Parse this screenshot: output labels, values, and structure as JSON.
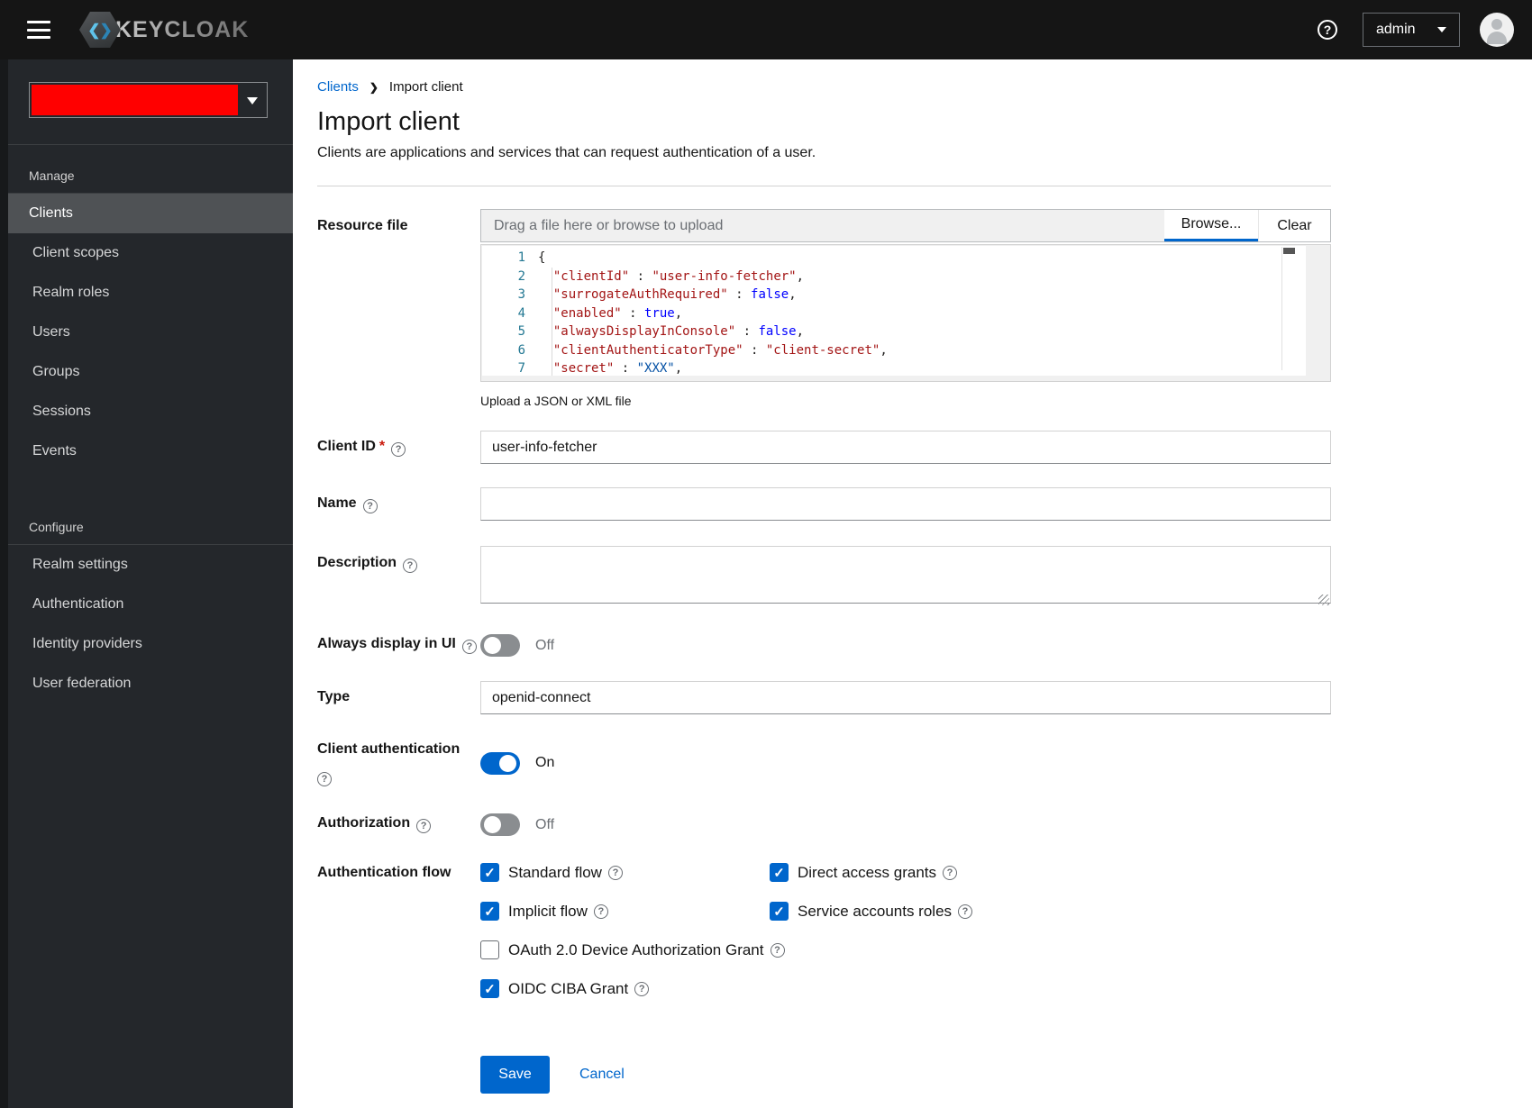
{
  "colors": {
    "accent_blue": "#0066cc",
    "header_bg": "#151515",
    "sidebar_bg": "#24272b",
    "nav_selected_bg": "#4f5255",
    "nav_accent": "#2b9af3",
    "realm_redaction": "#ff0000",
    "code_string": "#a31515",
    "code_boolean": "#0000ff",
    "code_secret_value": "#0451a5",
    "code_line_number": "#237893"
  },
  "header": {
    "brand": "KEYCLOAK",
    "user_menu": "admin",
    "icons": [
      "hamburger-icon",
      "question-circle-icon",
      "caret-down-icon",
      "user-avatar-icon"
    ]
  },
  "sidebar": {
    "realm_selector": {
      "value": "",
      "redacted": true
    },
    "sections": [
      {
        "label": "Manage",
        "items": [
          {
            "label": "Clients",
            "active": true
          },
          {
            "label": "Client scopes",
            "active": false
          },
          {
            "label": "Realm roles",
            "active": false
          },
          {
            "label": "Users",
            "active": false
          },
          {
            "label": "Groups",
            "active": false
          },
          {
            "label": "Sessions",
            "active": false
          },
          {
            "label": "Events",
            "active": false
          }
        ]
      },
      {
        "label": "Configure",
        "items": [
          {
            "label": "Realm settings",
            "active": false
          },
          {
            "label": "Authentication",
            "active": false
          },
          {
            "label": "Identity providers",
            "active": false
          },
          {
            "label": "User federation",
            "active": false
          }
        ]
      }
    ]
  },
  "breadcrumb": {
    "items": [
      {
        "label": "Clients"
      },
      {
        "label": "Import client"
      }
    ]
  },
  "page": {
    "title": "Import client",
    "subtitle": "Clients are applications and services that can request authentication of a user."
  },
  "form": {
    "resource_file": {
      "label": "Resource file",
      "drag_placeholder": "Drag a file here or browse to upload",
      "browse_label": "Browse...",
      "clear_label": "Clear",
      "helper": "Upload a JSON or XML file",
      "code_lines": [
        {
          "num": "1",
          "tokens": [
            {
              "cls": "t-plain",
              "v": "{"
            }
          ]
        },
        {
          "num": "2",
          "tokens": [
            {
              "cls": "t-plain",
              "v": "  "
            },
            {
              "cls": "t-str",
              "v": "\"clientId\""
            },
            {
              "cls": "t-plain",
              "v": " : "
            },
            {
              "cls": "t-str",
              "v": "\"user-info-fetcher\""
            },
            {
              "cls": "t-plain",
              "v": ","
            }
          ]
        },
        {
          "num": "3",
          "tokens": [
            {
              "cls": "t-plain",
              "v": "  "
            },
            {
              "cls": "t-str",
              "v": "\"surrogateAuthRequired\""
            },
            {
              "cls": "t-plain",
              "v": " : "
            },
            {
              "cls": "t-bool",
              "v": "false"
            },
            {
              "cls": "t-plain",
              "v": ","
            }
          ]
        },
        {
          "num": "4",
          "tokens": [
            {
              "cls": "t-plain",
              "v": "  "
            },
            {
              "cls": "t-str",
              "v": "\"enabled\""
            },
            {
              "cls": "t-plain",
              "v": " : "
            },
            {
              "cls": "t-bool",
              "v": "true"
            },
            {
              "cls": "t-plain",
              "v": ","
            }
          ]
        },
        {
          "num": "5",
          "tokens": [
            {
              "cls": "t-plain",
              "v": "  "
            },
            {
              "cls": "t-str",
              "v": "\"alwaysDisplayInConsole\""
            },
            {
              "cls": "t-plain",
              "v": " : "
            },
            {
              "cls": "t-bool",
              "v": "false"
            },
            {
              "cls": "t-plain",
              "v": ","
            }
          ]
        },
        {
          "num": "6",
          "tokens": [
            {
              "cls": "t-plain",
              "v": "  "
            },
            {
              "cls": "t-str",
              "v": "\"clientAuthenticatorType\""
            },
            {
              "cls": "t-plain",
              "v": " : "
            },
            {
              "cls": "t-str",
              "v": "\"client-secret\""
            },
            {
              "cls": "t-plain",
              "v": ","
            }
          ]
        },
        {
          "num": "7",
          "tokens": [
            {
              "cls": "t-plain",
              "v": "  "
            },
            {
              "cls": "t-str",
              "v": "\"secret\""
            },
            {
              "cls": "t-plain",
              "v": " : "
            },
            {
              "cls": "t-val-blue",
              "v": "\"XXX\""
            },
            {
              "cls": "t-plain",
              "v": ","
            }
          ]
        }
      ]
    },
    "client_id": {
      "label": "Client ID",
      "required_marker": "*",
      "value": "user-info-fetcher"
    },
    "name": {
      "label": "Name",
      "value": ""
    },
    "description": {
      "label": "Description",
      "value": ""
    },
    "always_display": {
      "label": "Always display in UI",
      "state_label": "Off",
      "on": false
    },
    "type": {
      "label": "Type",
      "value": "openid-connect"
    },
    "client_authentication": {
      "label": "Client authentication",
      "state_label": "On",
      "on": true
    },
    "authorization": {
      "label": "Authorization",
      "state_label": "Off",
      "on": false
    },
    "authentication_flow": {
      "label": "Authentication flow",
      "options": [
        {
          "label": "Standard flow",
          "checked": true,
          "wide": false
        },
        {
          "label": "Direct access grants",
          "checked": true,
          "wide": false
        },
        {
          "label": "Implicit flow",
          "checked": true,
          "wide": false
        },
        {
          "label": "Service accounts roles",
          "checked": true,
          "wide": false
        },
        {
          "label": "OAuth 2.0 Device Authorization Grant",
          "checked": false,
          "wide": true
        },
        {
          "label": "OIDC CIBA Grant",
          "checked": true,
          "wide": true
        }
      ]
    },
    "actions": {
      "save": "Save",
      "cancel": "Cancel"
    }
  }
}
